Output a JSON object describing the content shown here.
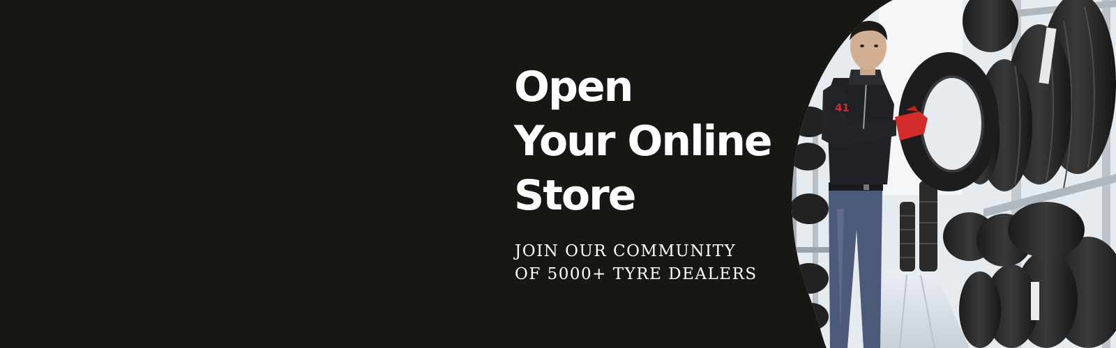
{
  "hero": {
    "headline_lines": [
      "Open",
      "Your Online",
      "Store"
    ],
    "subline_lines": [
      "JOIN OUR COMMUNITY",
      "OF 5000+ TYRE DEALERS"
    ],
    "badge_number": "41"
  },
  "colors": {
    "background": "#171714",
    "text": "#ffffff",
    "glove": "#d42b2b",
    "shirt": "#1f2126",
    "jeans": "#4a5a78"
  }
}
